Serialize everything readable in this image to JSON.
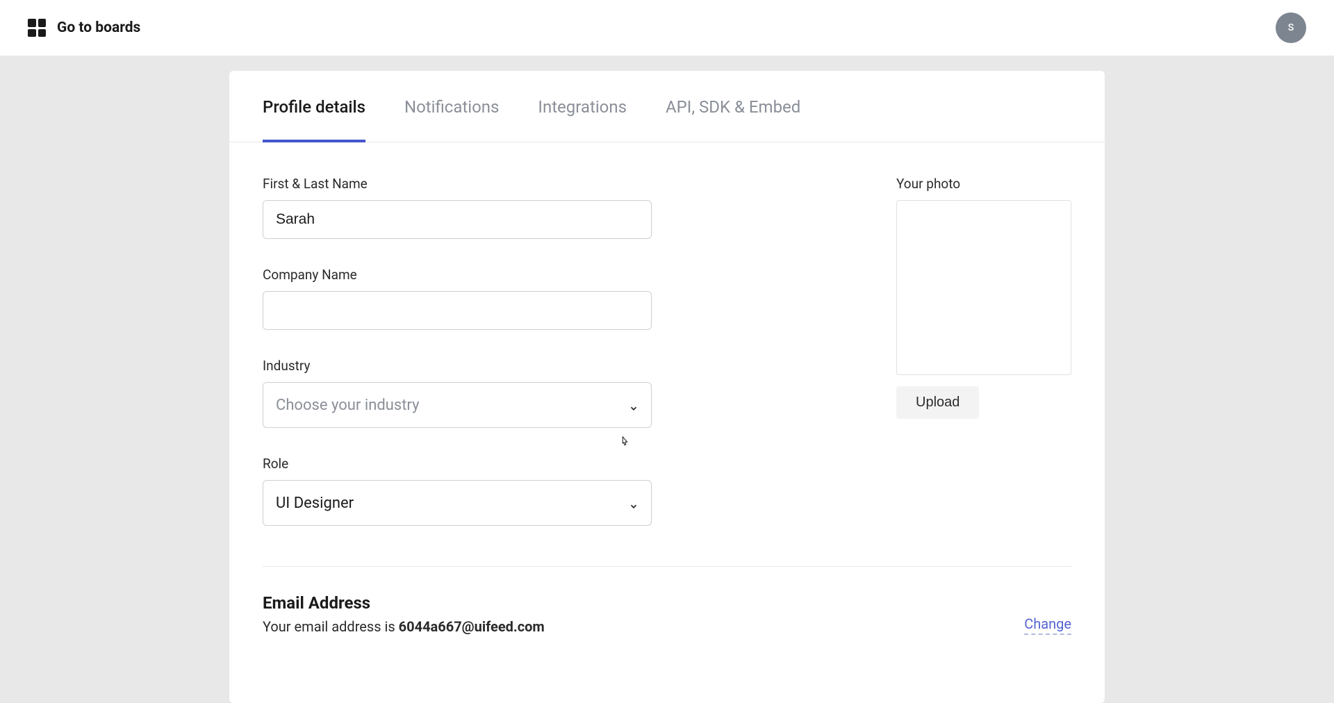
{
  "header": {
    "go_to_boards": "Go to boards",
    "avatar_initial": "S"
  },
  "tabs": [
    {
      "label": "Profile details",
      "active": true
    },
    {
      "label": "Notifications",
      "active": false
    },
    {
      "label": "Integrations",
      "active": false
    },
    {
      "label": "API, SDK & Embed",
      "active": false
    }
  ],
  "form": {
    "name": {
      "label": "First & Last Name",
      "value": "Sarah"
    },
    "company": {
      "label": "Company Name",
      "value": ""
    },
    "industry": {
      "label": "Industry",
      "placeholder": "Choose your industry",
      "value": ""
    },
    "role": {
      "label": "Role",
      "value": "UI Designer"
    }
  },
  "photo": {
    "label": "Your photo",
    "upload_label": "Upload"
  },
  "email": {
    "heading": "Email Address",
    "prefix": "Your email address is ",
    "value": "6044a667@uifeed.com",
    "change_label": "Change"
  }
}
